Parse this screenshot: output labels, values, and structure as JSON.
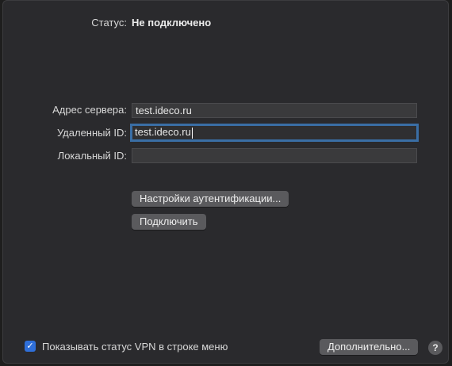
{
  "status": {
    "label": "Статус:",
    "value": "Не подключено"
  },
  "form": {
    "server_address": {
      "label": "Адрес сервера:",
      "value": "test.ideco.ru"
    },
    "remote_id": {
      "label": "Удаленный ID:",
      "value": "test.ideco.ru"
    },
    "local_id": {
      "label": "Локальный ID:",
      "value": ""
    }
  },
  "buttons": {
    "auth_settings": "Настройки аутентификации...",
    "connect": "Подключить",
    "advanced": "Дополнительно...",
    "help": "?"
  },
  "options": {
    "show_vpn_status_label": "Показывать статус VPN в строке меню",
    "show_vpn_status_checked": true
  },
  "icons": {
    "check": "✓"
  },
  "colors": {
    "accent": "#2f6fd9",
    "focus_ring": "#3a6ea5"
  }
}
